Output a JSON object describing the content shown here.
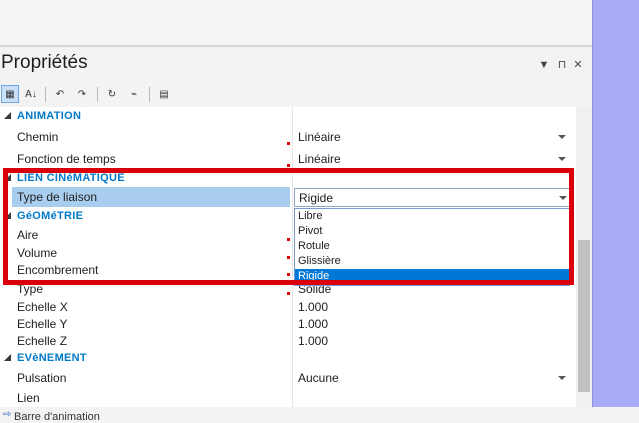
{
  "panel": {
    "title": "Propriétés",
    "controls": {
      "menu": "▼",
      "pin": "⊓",
      "close": "✕"
    }
  },
  "toolbar": {
    "buttons": [
      {
        "name": "categorized-button",
        "glyph": "▦",
        "active": true
      },
      {
        "name": "alphabetical-button",
        "glyph": "A↓"
      },
      {
        "name": "expand-all-button",
        "glyph": "↶"
      },
      {
        "name": "collapse-all-button",
        "glyph": "↷"
      },
      {
        "name": "refresh-button",
        "glyph": "↻"
      },
      {
        "name": "pick-button",
        "glyph": "⌁"
      },
      {
        "name": "property-pages-button",
        "glyph": "▤"
      }
    ]
  },
  "grid": {
    "categories": {
      "animation": "ANIMATION",
      "lien": "LIEN CINéMATIQUE",
      "geometrie": "GéOMéTRIE",
      "evenement": "EVèNEMENT"
    },
    "rows": {
      "chemin": {
        "name": "Chemin",
        "value": "Linéaire"
      },
      "fonction": {
        "name": "Fonction de temps",
        "value": "Linéaire"
      },
      "type_liaison": {
        "name": "Type de liaison",
        "value": "Rigide"
      },
      "aire": {
        "name": "Aire",
        "value": ""
      },
      "volume": {
        "name": "Volume",
        "value": ""
      },
      "encombrement": {
        "name": "Encombrement",
        "value": ""
      },
      "type": {
        "name": "Type",
        "value": "Solide"
      },
      "echelle_x": {
        "name": "Echelle X",
        "value": "1.000"
      },
      "echelle_y": {
        "name": "Echelle Y",
        "value": "1.000"
      },
      "echelle_z": {
        "name": "Echelle Z",
        "value": "1.000"
      },
      "pulsation": {
        "name": "Pulsation",
        "value": "Aucune"
      },
      "lien": {
        "name": "Lien",
        "value": ""
      }
    }
  },
  "dropdown": {
    "options": [
      "Libre",
      "Pivot",
      "Rotule",
      "Glissière",
      "Rigide"
    ],
    "selected": "Rigide"
  },
  "bottom": {
    "label": "Barre d'animation"
  },
  "colors": {
    "accent": "#0079c9",
    "highlight": "#d9000b",
    "selection": "#0078d7",
    "side_panel": "#a9aaf8"
  }
}
